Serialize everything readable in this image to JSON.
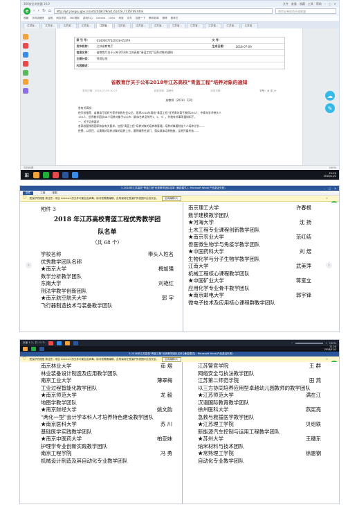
{
  "browser": {
    "window_title": "360安全浏览器 10.0",
    "window_controls": [
      "文件",
      "查看",
      "收藏",
      "工具",
      "帮助"
    ],
    "url": "http://jyt.jiangsu.gov.cn/art/2018/7/9/art_61419_7735749.html",
    "search_placeholder": "南京证券投资开放联盟",
    "bookmarks": [
      "收藏",
      "手机收藏夹",
      "谷歌",
      "网址导航",
      "360搜索",
      "游戏中心",
      "Lenovo",
      "Links",
      "淘宝",
      "京东",
      "百度一下",
      "腾讯新闻",
      "微博",
      "爱奇艺"
    ],
    "tabs": [
      "江苏省...",
      "江苏省...",
      "江苏省...",
      "江苏省...",
      "江苏省...",
      "江苏省...",
      "江苏省...",
      "江苏省...",
      "江苏省...",
      "江苏省...",
      "江苏省...",
      "江苏省...",
      "江苏省..."
    ],
    "active_tab": 4,
    "meta": {
      "index_label": "索 引 号：",
      "index_value": "014000773/2018-05379",
      "wenhao_label": "文 号：",
      "wenhao_value": "",
      "org_label": "发布机构：",
      "org_value": "江苏省教育厅",
      "date_label": "生成日期：",
      "date_value": "2018-07-09",
      "title_label": "信息名称：",
      "title_value": "省教育厅关于公布2018年江苏高校“青蓝工程”培养对象的通知",
      "subject_label": "主题分类：",
      "subject_value": "师资队伍",
      "summary_label": "内容概述：",
      "summary_value": ""
    },
    "doc_title": "省教育厅关于公布2018年江苏高校“青蓝工程”培养对象的通知",
    "doc_date": "发布日期：2018-07-09 10:27",
    "doc_source": "信息来源：高教处",
    "doc_views": "浏览次数：",
    "font_size_label": "字号：",
    "font_size_options": "大 中 小",
    "doc_number": "苏教师〔2018〕12号",
    "body_lines": [
      "各有关高校：",
      "    经学校推荐、省教育厅组织专家评审和社会公示，现将2018年高校“青蓝工程”优秀青年骨干教师250人、中青年学术带头人",
      "155人、优秀教学团队68个培养对象予以公布（具体名单见附件1、2、3），并就有关事项通知如下。",
      "    一、关于培养要求",
      "    各高校要按照国家和省有关要求，加强“青蓝工程”培养对象的培养和管理。培养对象要制定个人培养计划……",
      "    经费，以项目、认真做好培养对象的培养工作，要明确责任部门、落实具体培养措施，定期开展考核……"
    ],
    "status_left": "今日优选",
    "status_right": "100%",
    "clock_time": "21:20",
    "clock_date": "2018/11/1"
  },
  "word1": {
    "title": "5-2018年江苏高校“青蓝工程”优秀教学团队名单 [兼容模式] - Microsoft Word(产品激活失败)",
    "menu": [
      "文件",
      "工具",
      "视图"
    ],
    "protected_view": "受保护的视图  请注意 - 来自 Internet 的文件可能包含病毒。除非您需要编辑，否则保持在受保护的视图中比较安全。",
    "enable_editing": "启用编辑(E)"
  },
  "word2": {
    "title": "5-2018年江苏高校“青蓝工程”优秀教学团队名单 [兼容模式] - Microsoft Word(产品激活失败)",
    "menu": [
      "文件",
      "工具",
      "视图"
    ],
    "protected_view": "受保护的视图  请注意 - 来自 Internet 的文件可能包含病毒。除非您需要编辑，否则保持在受保护的视图中比较安全。",
    "enable_editing": "启用编辑(E)",
    "page_indicator": "页面 1-2，共 11 个",
    "zoom": "150%",
    "clock_time": "21:20",
    "clock_date": "2018/11/1"
  },
  "doc": {
    "attachment": "附件 3",
    "heading_line1": "2018 年江苏高校青蓝工程优秀教学团",
    "heading_line2": "队名单",
    "count": "（共 68 个）",
    "col_school": "学校名称",
    "col_leader": "带头人姓名",
    "col_team": "优秀教学团队名称"
  },
  "list_page1_left": [
    {
      "school": "★南京大学",
      "leader": "梅加强",
      "team": "数学分析教学团队"
    },
    {
      "school": "东南大学",
      "leader": "刘艳红",
      "team": "刑法学教学创新团队"
    },
    {
      "school": "★南京航空航天大学",
      "leader": "郭 宇",
      "team": "飞行器制造技术与装备教学团队"
    }
  ],
  "list_page1_right": [
    {
      "school": "南京理工大学",
      "leader": "许春根",
      "team": "数学建模教学团队"
    },
    {
      "school": "★河海大学",
      "leader": "沈 扬",
      "team": "土木工程专业课程创新教学团队"
    },
    {
      "school": "★南京农业大学",
      "leader": "范红结",
      "team": "兽医微生物学与免疫学教学团队"
    },
    {
      "school": "★中国药科大学",
      "leader": "刘 煜",
      "team": "生物化学与分子生物学教学团队"
    },
    {
      "school": "江南大学",
      "leader": "武美萍",
      "team": "机械工程核心课程教学团队"
    },
    {
      "school": "★中国矿业大学",
      "leader": "蒋室立",
      "team": "应用化学专业骨干教学团队"
    },
    {
      "school": "★南京邮电大学",
      "leader": "郭宇锋",
      "team": "微电子技术及应用核心课程群教学团队"
    }
  ],
  "list_page2_left": [
    {
      "school": "南京林业大学",
      "leader": "茹 煜",
      "team": "林业装备设计制造及应用教学团队"
    },
    {
      "school": "南京工业大学",
      "leader": "薄翠梅",
      "team": "工业过程智能化教学团队"
    },
    {
      "school": "★南京师范大学",
      "leader": "龙 毅",
      "team": "地图学教学团队"
    },
    {
      "school": "★南京财经大学",
      "leader": "姚文韵",
      "team": "“两化一型”会计学本科人才培养特色建设教学团队"
    },
    {
      "school": "★南京医科大学",
      "leader": "苏 川",
      "team": "基础医学实践教学团队"
    },
    {
      "school": "★南京中医药大学",
      "leader": "柏亚妹",
      "team": "护理学专业创新实践教学团队"
    },
    {
      "school": "南京工程学院",
      "leader": "冯 勇",
      "team": "机械设计制造及其自动化专业教学团队"
    }
  ],
  "list_page2_right": [
    {
      "school": "江苏警官学院",
      "leader": "王 群",
      "team": "网络安全与执法教学团队"
    },
    {
      "school": "江苏第二师范学院",
      "leader": "田 燕",
      "team": "以三方协同培养应用型卓越幼儿园教师的教学团队"
    },
    {
      "school": "★江苏师范大学",
      "leader": "满在江",
      "team": "汉语国际教育教学团队"
    },
    {
      "school": "徐州医科大学",
      "leader": "燕宪亮",
      "team": "急救与救援医学教学团队"
    },
    {
      "school": "★江苏理工学院",
      "leader": "贝绍轶",
      "team": "新能源汽车控制与运用工程教学团队"
    },
    {
      "school": "★苏州大学",
      "leader": "王穗东",
      "team": "纳米材料与技术团队"
    },
    {
      "school": "★常熟理工学院",
      "leader": "徐惠钢",
      "team": "自动化专业教学团队"
    }
  ],
  "colors": {
    "browser_accent": "#1fae3c",
    "word_titlebar": "#2b579a",
    "protected_bar": "#fff6c9",
    "doc_title_red": "#b02a2a",
    "float_blue": "#35b9e9",
    "green_badge": "#27b24a"
  },
  "icons": {
    "browser_logo": "360-logo-icon",
    "shield": "shield-icon",
    "next_page": "chevron-right-icon",
    "prev_page": "chevron-left-icon",
    "windows": "windows-start-icon"
  }
}
